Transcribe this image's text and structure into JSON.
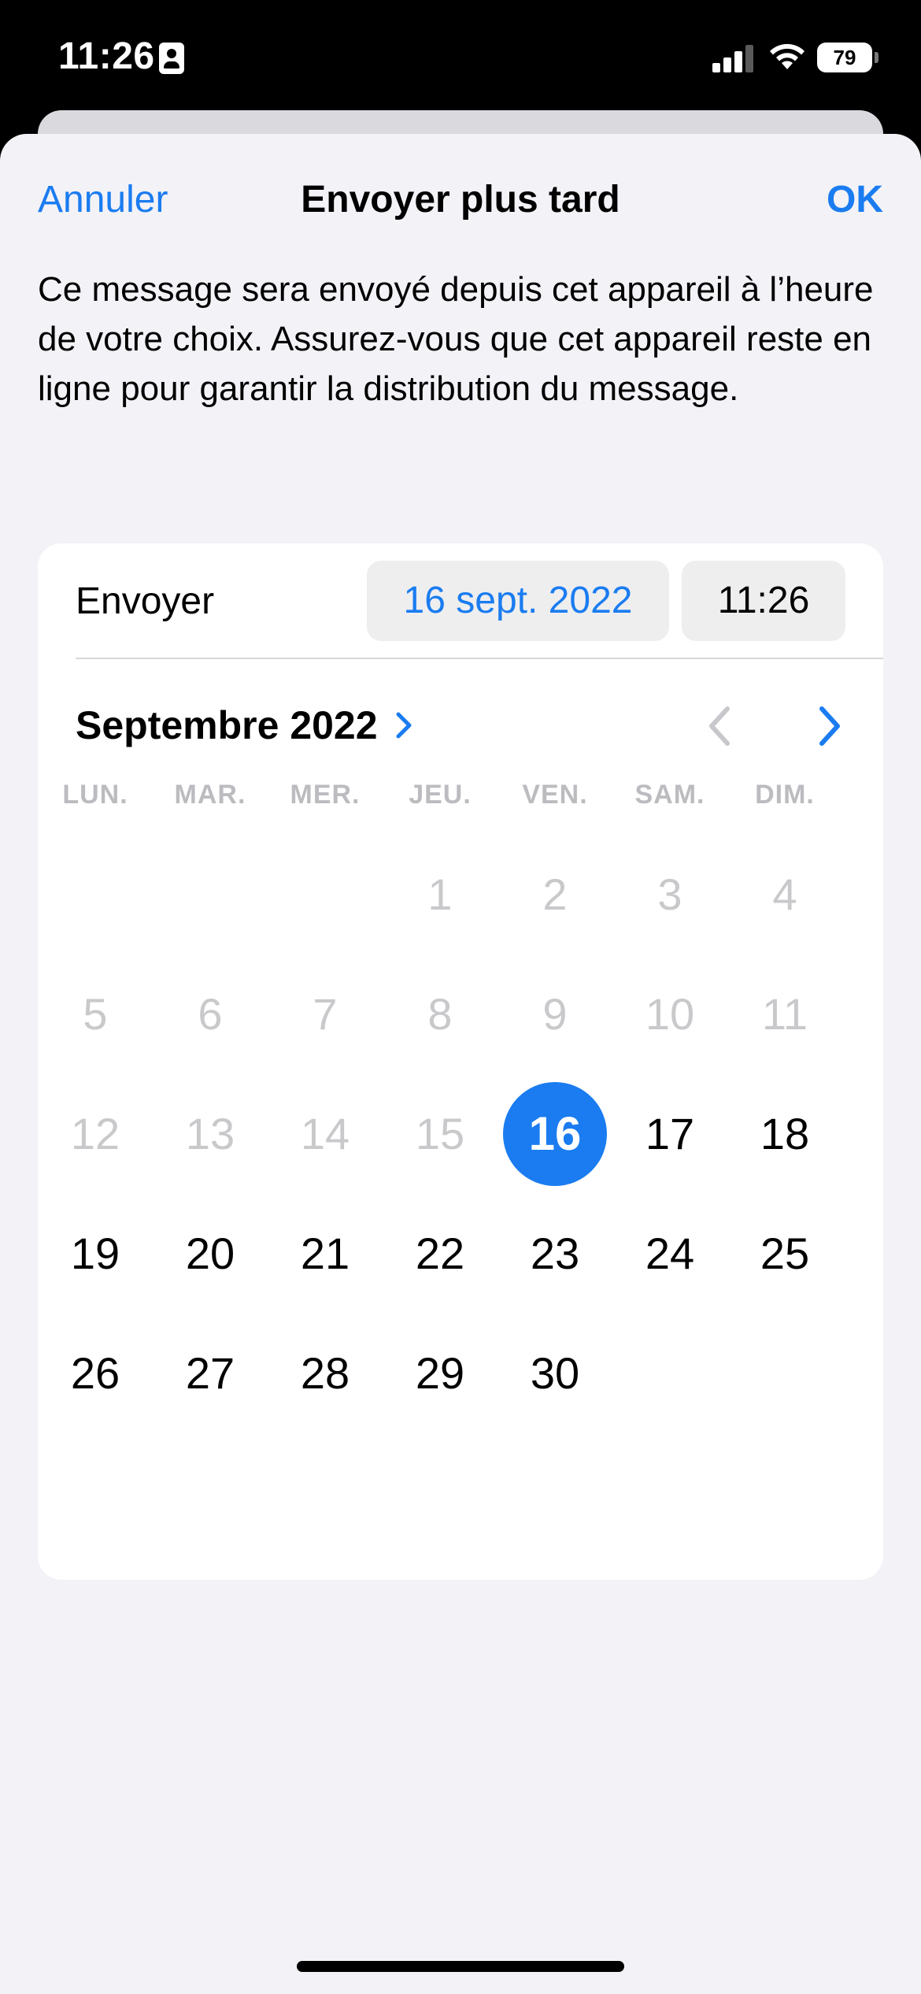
{
  "status_bar": {
    "time": "11:26",
    "battery": "79",
    "icons": [
      "contact-card-icon",
      "cellular-signal-icon",
      "wifi-icon",
      "battery-icon"
    ]
  },
  "nav": {
    "cancel_label": "Annuler",
    "title": "Envoyer plus tard",
    "ok_label": "OK"
  },
  "description": "Ce message sera envoyé depuis cet appareil à l’heure de votre choix. Assurez-vous que cet appareil reste en ligne pour garantir la distribution du message.",
  "schedule": {
    "send_label": "Envoyer",
    "date_value": "16 sept. 2022",
    "time_value": "11:26"
  },
  "calendar": {
    "month_label": "Septembre 2022",
    "weekdays": [
      "LUN.",
      "MAR.",
      "MER.",
      "JEU.",
      "VEN.",
      "SAM.",
      "DIM."
    ],
    "first_weekday_index": 3,
    "days_in_month": 30,
    "selected_day": 16,
    "first_enabled_day": 16
  },
  "colors": {
    "accent": "#1a7cf0",
    "sheet_background": "#f2f2f7",
    "card_background": "#ffffff",
    "disabled_text": "#c9c9cc",
    "weekday_text": "#bcbcc0"
  }
}
